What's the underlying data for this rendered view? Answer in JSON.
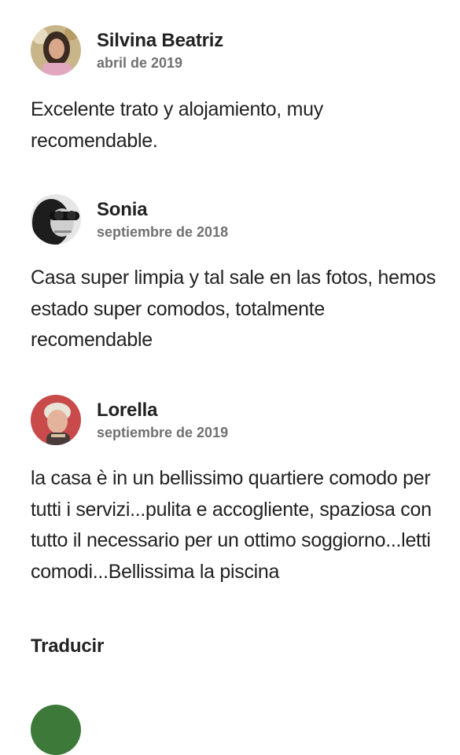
{
  "reviews": [
    {
      "author": "Silvina Beatriz",
      "date": "abril de 2019",
      "text": "Excelente trato y alojamiento, muy recomendable."
    },
    {
      "author": "Sonia",
      "date": "septiembre de 2018",
      "text": "Casa super limpia y tal sale en las fotos, hemos estado super comodos, totalmente recomendable"
    },
    {
      "author": "Lorella",
      "date": "septiembre de 2019",
      "text": "la casa è in un bellissimo quartiere comodo per tutti i servizi...pulita e accogliente, spaziosa con tutto il necessario per un ottimo soggiorno...letti comodi...Bellissima la piscina"
    }
  ],
  "translate_label": "Traducir",
  "colors": {
    "text": "#222222",
    "muted": "#717171"
  }
}
